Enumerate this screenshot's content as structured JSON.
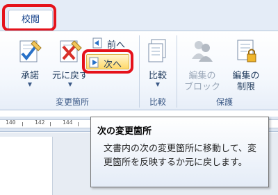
{
  "tabs": {
    "review": "校閲"
  },
  "ribbon": {
    "groups": {
      "changes": "変更箇所",
      "compare": "比較",
      "protect": "保護"
    },
    "buttons": {
      "accept": "承諾",
      "reject": "元に戻す",
      "previous": "前へ",
      "next": "次へ",
      "compare": "比較",
      "block_authors_line1": "編集の",
      "block_authors_line2": "ブロック",
      "restrict_line1": "編集の",
      "restrict_line2": "制限"
    }
  },
  "ruler": {
    "ticks": [
      "140",
      "142",
      "144"
    ]
  },
  "tooltip": {
    "title": "次の変更箇所",
    "body": "文書内の次の変更箇所に移動して、変更箇所を反映するか元に戻します。"
  },
  "colors": {
    "highlight": "#e5121b",
    "hover": "#ffd96a",
    "accent": "#15428b"
  }
}
